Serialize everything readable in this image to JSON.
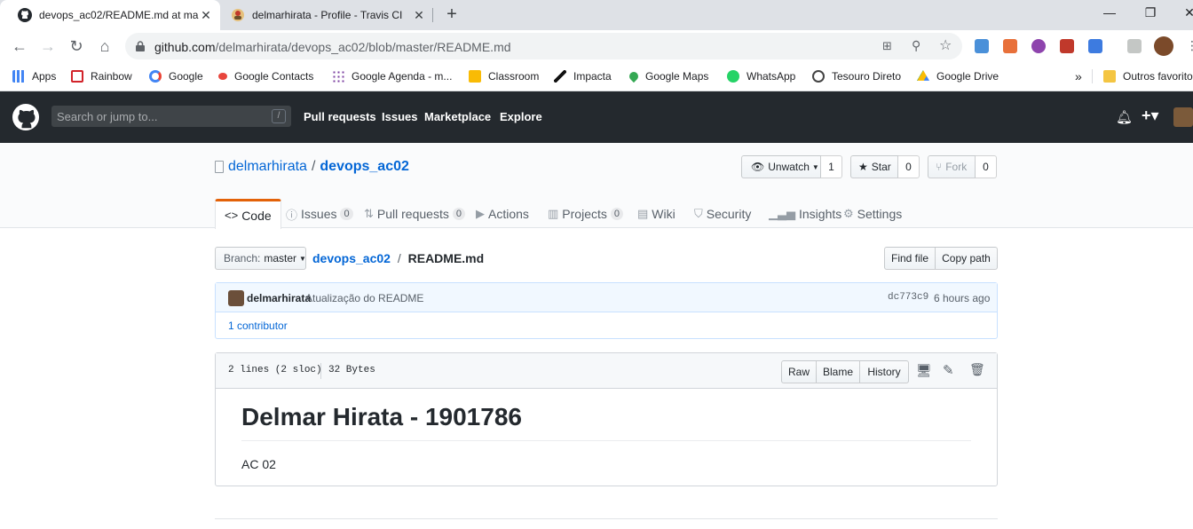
{
  "browser": {
    "tabs": [
      {
        "title": "devops_ac02/README.md at ma",
        "active": true,
        "icon": "github-icon"
      },
      {
        "title": "delmarhirata - Profile - Travis CI",
        "active": false,
        "icon": "travis-icon"
      }
    ],
    "new_tab": "+",
    "url_host": "github.com",
    "url_path": "/delmarhirata/devops_ac02/blob/master/README.md",
    "bookmarks": [
      {
        "label": "Apps",
        "icon": "apps-grid-icon"
      },
      {
        "label": "Rainbow",
        "icon": "rainbow-icon"
      },
      {
        "label": "Google",
        "icon": "google-icon"
      },
      {
        "label": "Google Contacts",
        "icon": "contacts-icon"
      },
      {
        "label": "Google Agenda - m...",
        "icon": "agenda-icon"
      },
      {
        "label": "Classroom",
        "icon": "classroom-icon"
      },
      {
        "label": "Impacta",
        "icon": "impacta-icon"
      },
      {
        "label": "Google Maps",
        "icon": "maps-icon"
      },
      {
        "label": "WhatsApp",
        "icon": "whatsapp-icon"
      },
      {
        "label": "Tesouro Direto",
        "icon": "tesouro-icon"
      },
      {
        "label": "Google Drive",
        "icon": "drive-icon"
      }
    ],
    "bookmarks_more": "»",
    "other_bookmarks": "Outros favoritos"
  },
  "github": {
    "search_placeholder": "Search or jump to...",
    "search_key": "/",
    "nav": [
      "Pull requests",
      "Issues",
      "Marketplace",
      "Explore"
    ],
    "repo_owner": "delmarhirata",
    "repo_sep": "/",
    "repo_name": "devops_ac02",
    "unwatch_label": "Unwatch",
    "watch_count": "1",
    "star_label": "Star",
    "star_count": "0",
    "fork_label": "Fork",
    "fork_count": "0",
    "tabs": [
      {
        "label": "Code",
        "icon": "code-icon",
        "count": ""
      },
      {
        "label": "Issues",
        "icon": "issue-icon",
        "count": "0"
      },
      {
        "label": "Pull requests",
        "icon": "pull-request-icon",
        "count": "0"
      },
      {
        "label": "Actions",
        "icon": "play-icon",
        "count": ""
      },
      {
        "label": "Projects",
        "icon": "project-icon",
        "count": "0"
      },
      {
        "label": "Wiki",
        "icon": "book-icon",
        "count": ""
      },
      {
        "label": "Security",
        "icon": "shield-icon",
        "count": ""
      },
      {
        "label": "Insights",
        "icon": "graph-icon",
        "count": ""
      },
      {
        "label": "Settings",
        "icon": "gear-icon",
        "count": ""
      }
    ],
    "branch_prefix": "Branch:",
    "branch_name": "master",
    "breadcrumb_repo": "devops_ac02",
    "breadcrumb_sep": "/",
    "breadcrumb_file": "README.md",
    "find_file": "Find file",
    "copy_path": "Copy path",
    "commit_author": "delmarhirata",
    "commit_message": "Atualização do README",
    "commit_sha": "dc773c9",
    "commit_time": "6 hours ago",
    "contributors": "1 contributor",
    "file_lines": "2 lines (2 sloc)",
    "file_size": "32 Bytes",
    "raw": "Raw",
    "blame": "Blame",
    "history": "History",
    "readme_title": "Delmar Hirata - 1901786",
    "readme_body": "AC 02"
  }
}
